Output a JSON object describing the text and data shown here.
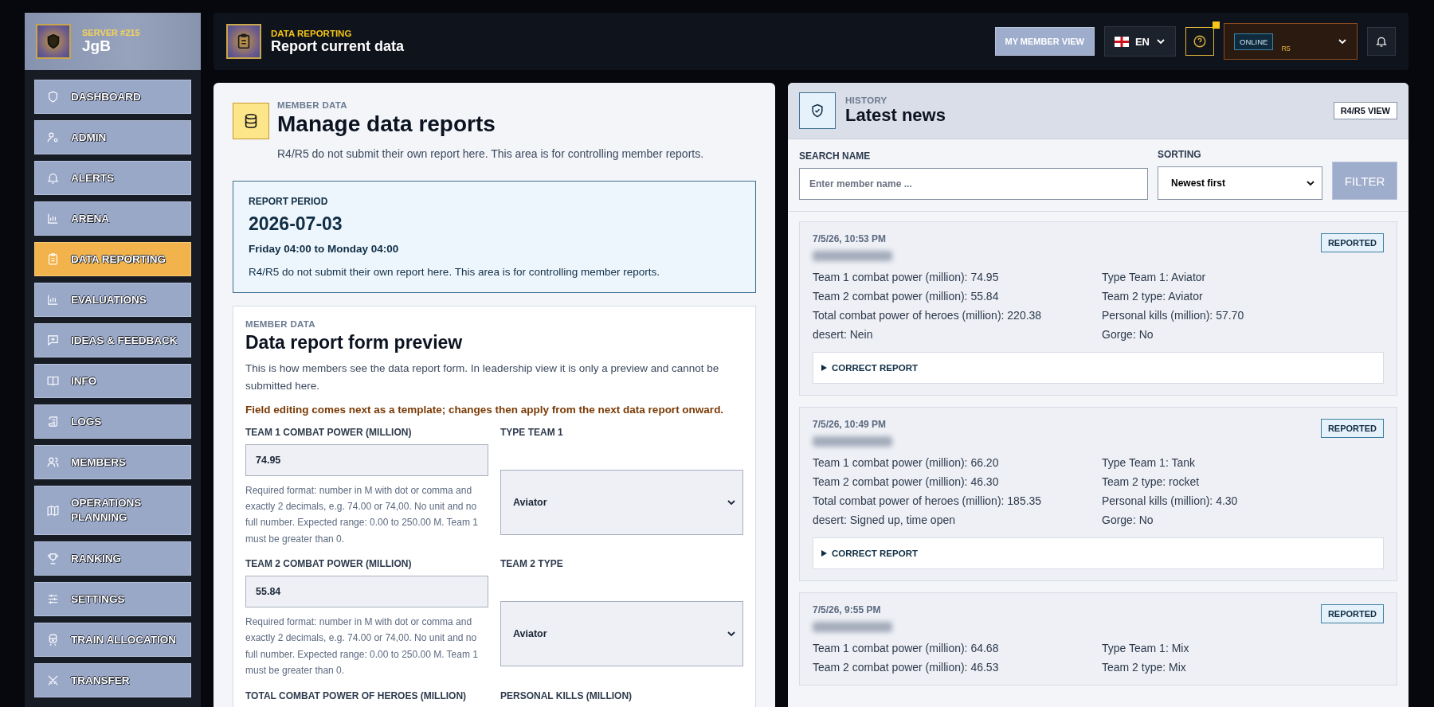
{
  "sidebar": {
    "server_label": "SERVER #215",
    "name": "JgB",
    "items": [
      {
        "label": "DASHBOARD",
        "selected": false
      },
      {
        "label": "ADMIN",
        "selected": false
      },
      {
        "label": "ALERTS",
        "selected": false
      },
      {
        "label": "ARENA",
        "selected": false
      },
      {
        "label": "DATA REPORTING",
        "selected": true
      },
      {
        "label": "EVALUATIONS",
        "selected": false
      },
      {
        "label": "IDEAS & FEEDBACK",
        "selected": false
      },
      {
        "label": "INFO",
        "selected": false
      },
      {
        "label": "LOGS",
        "selected": false
      },
      {
        "label": "MEMBERS",
        "selected": false
      },
      {
        "label": "OPERATIONS PLANNING",
        "selected": false
      },
      {
        "label": "RANKING",
        "selected": false
      },
      {
        "label": "SETTINGS",
        "selected": false
      },
      {
        "label": "TRAIN ALLOCATION",
        "selected": false
      },
      {
        "label": "TRANSFER",
        "selected": false
      }
    ]
  },
  "topbar": {
    "section": "DATA REPORTING",
    "title": "Report current data",
    "member_view_button": "MY MEMBER VIEW",
    "language": "EN",
    "help_notification": true,
    "status": "ONLINE",
    "rank": "R5"
  },
  "main": {
    "eyebrow": "MEMBER DATA",
    "title": "Manage data reports",
    "subtitle": "R4/R5 do not submit their own report here. This area is for controlling member reports.",
    "period": {
      "label": "REPORT PERIOD",
      "date": "2026-07-03",
      "range": "Friday 04:00 to Monday 04:00",
      "note": "R4/R5 do not submit their own report here. This area is for controlling member reports."
    },
    "preview": {
      "eyebrow": "MEMBER DATA",
      "title": "Data report form preview",
      "description": "This is how members see the data report form. In leadership view it is only a preview and cannot be submitted here.",
      "notice": "Field editing comes next as a template; changes then apply from the next data report onward.",
      "fields": [
        {
          "kind": "number",
          "label": "TEAM 1 COMBAT POWER (MILLION)",
          "value": "74.95",
          "help": "Required format: number in M with dot or comma and exactly 2 decimals, e.g. 74.00 or 74,00. No unit and no full number. Expected range: 0.00 to 250.00 M. Team 1 must be greater than 0."
        },
        {
          "kind": "select",
          "label": "TYPE TEAM 1",
          "value": "Aviator"
        },
        {
          "kind": "number",
          "label": "TEAM 2 COMBAT POWER (MILLION)",
          "value": "55.84",
          "help": "Required format: number in M with dot or comma and exactly 2 decimals, e.g. 74.00 or 74,00. No unit and no full number. Expected range: 0.00 to 250.00 M. Team 1 must be greater than 0."
        },
        {
          "kind": "select",
          "label": "TEAM 2 TYPE",
          "value": "Aviator"
        },
        {
          "kind": "number",
          "label": "TOTAL COMBAT POWER OF HEROES (MILLION)"
        },
        {
          "kind": "number",
          "label": "PERSONAL KILLS (MILLION)"
        }
      ]
    }
  },
  "history": {
    "eyebrow": "HISTORY",
    "title": "Latest news",
    "view_badge": "R4/R5 VIEW",
    "filter": {
      "search_label": "SEARCH NAME",
      "search_placeholder": "Enter member name ...",
      "sort_label": "SORTING",
      "sort_value": "Newest first",
      "button": "FILTER"
    },
    "entries": [
      {
        "time": "7/5/26, 10:53 PM",
        "status": "REPORTED",
        "details": [
          "Team 1 combat power (million): 74.95",
          "Type Team 1: Aviator",
          "Team 2 combat power (million): 55.84",
          "Team 2 type: Aviator",
          "Total combat power of heroes (million): 220.38",
          "Personal kills (million): 57.70",
          "desert: Nein",
          "Gorge: No"
        ],
        "action": "CORRECT REPORT"
      },
      {
        "time": "7/5/26, 10:49 PM",
        "status": "REPORTED",
        "details": [
          "Team 1 combat power (million): 66.20",
          "Type Team 1: Tank",
          "Team 2 combat power (million): 46.30",
          "Team 2 type: rocket",
          "Total combat power of heroes (million): 185.35",
          "Personal kills (million): 4.30",
          "desert: Signed up, time open",
          "Gorge: No"
        ],
        "action": "CORRECT REPORT"
      },
      {
        "time": "7/5/26, 9:55 PM",
        "status": "REPORTED",
        "details": [
          "Team 1 combat power (million): 64.68",
          "Type Team 1: Mix",
          "Team 2 combat power (million): 46.53",
          "Team 2 type: Mix"
        ]
      }
    ]
  }
}
